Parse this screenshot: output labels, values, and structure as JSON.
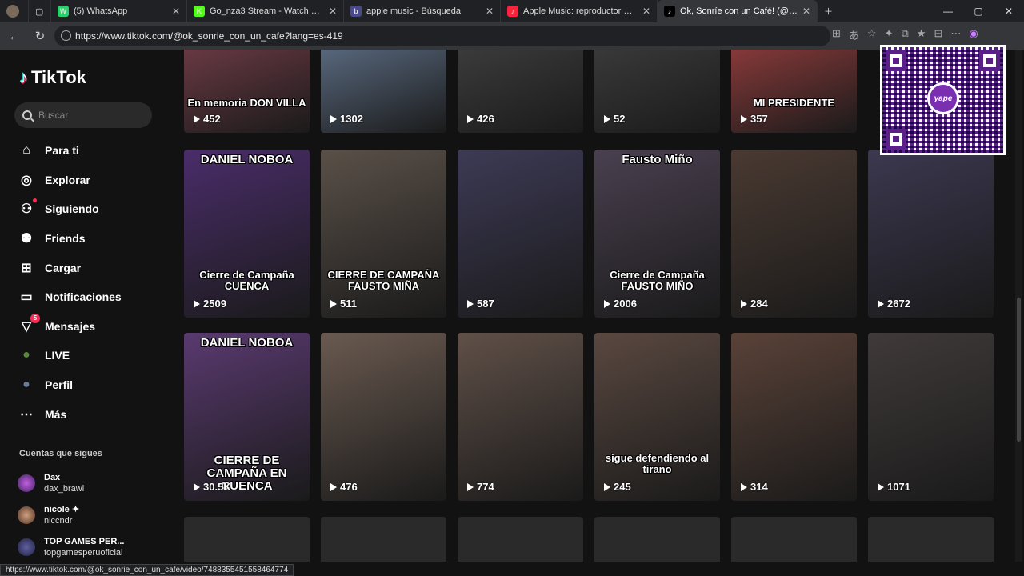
{
  "browser": {
    "tabs": [
      {
        "title": "(5) WhatsApp",
        "color": "#25d366",
        "glyph": "W"
      },
      {
        "title": "Go_nza3 Stream - Watch Live on Kick",
        "color": "#53fc18",
        "glyph": "K"
      },
      {
        "title": "apple music - Búsqueda",
        "color": "#4a4a8a",
        "glyph": "b"
      },
      {
        "title": "Apple Music: reproductor web",
        "color": "#fa233b",
        "glyph": "♪"
      },
      {
        "title": "Ok, Sonríe con un Café! (@ok_sonrie_con_un_cafe)",
        "color": "#000000",
        "glyph": "♪"
      }
    ],
    "url": "https://www.tiktok.com/@ok_sonrie_con_un_cafe?lang=es-419",
    "status_url": "https://www.tiktok.com/@ok_sonrie_con_un_cafe/video/7488355451558464774"
  },
  "sidebar": {
    "logo": "TikTok",
    "search_placeholder": "Buscar",
    "nav": [
      {
        "label": "Para ti",
        "icon": "home-icon"
      },
      {
        "label": "Explorar",
        "icon": "compass-icon"
      },
      {
        "label": "Siguiendo",
        "icon": "following-icon"
      },
      {
        "label": "Friends",
        "icon": "friends-icon"
      },
      {
        "label": "Cargar",
        "icon": "upload-icon"
      },
      {
        "label": "Notificaciones",
        "icon": "inbox-icon"
      },
      {
        "label": "Mensajes",
        "icon": "messages-icon",
        "badge": "5"
      },
      {
        "label": "LIVE",
        "icon": "live-icon"
      },
      {
        "label": "Perfil",
        "icon": "profile-icon"
      },
      {
        "label": "Más",
        "icon": "more-icon"
      }
    ],
    "following_header": "Cuentas que sigues",
    "accounts": [
      {
        "name": "Dax",
        "handle": "dax_brawl"
      },
      {
        "name": "nicole ✦",
        "handle": "niccndr"
      },
      {
        "name": "TOP GAMES PER...",
        "handle": "topgamesperuoficial"
      }
    ]
  },
  "grid": {
    "rows": [
      [
        {
          "views": "452",
          "caption": "En memoria DON VILLA",
          "bg": "#6b3a44"
        },
        {
          "views": "1302",
          "bg": "#5a6a80"
        },
        {
          "views": "426",
          "bg": "#3c3c3c"
        },
        {
          "views": "52",
          "bg": "#3a3a3a"
        },
        {
          "views": "357",
          "caption": "MI PRESIDENTE",
          "bg": "#8a3a3a"
        }
      ],
      [
        {
          "views": "2509",
          "top": "DANIEL NOBOA",
          "caption": "Cierre de Campaña CUENCA",
          "bg": "#4a2d6a"
        },
        {
          "views": "511",
          "caption": "CIERRE DE CAMPAÑA FAUSTO MIÑA",
          "bg": "#5a5048"
        },
        {
          "views": "587",
          "bg": "#3d3a55"
        },
        {
          "views": "2006",
          "top": "Fausto Miño",
          "caption": "Cierre de Campaña FAUSTO MIÑO",
          "bg": "#4a4050"
        },
        {
          "views": "284",
          "bg": "#4a3a32"
        },
        {
          "views": "2672",
          "bg": "#3c3850"
        }
      ],
      [
        {
          "views": "30.5K",
          "top": "DANIEL NOBOA",
          "caption": "CIERRE DE CAMPAÑA EN CUENCA",
          "bg": "#5a3a70"
        },
        {
          "views": "476",
          "bg": "#6a5a50"
        },
        {
          "views": "774",
          "bg": "#605048"
        },
        {
          "views": "245",
          "caption": "sigue defendiendo al tirano",
          "bg": "#5a4840"
        },
        {
          "views": "314",
          "bg": "#5a4238"
        },
        {
          "views": "1071",
          "bg": "#403a3a"
        }
      ]
    ]
  }
}
